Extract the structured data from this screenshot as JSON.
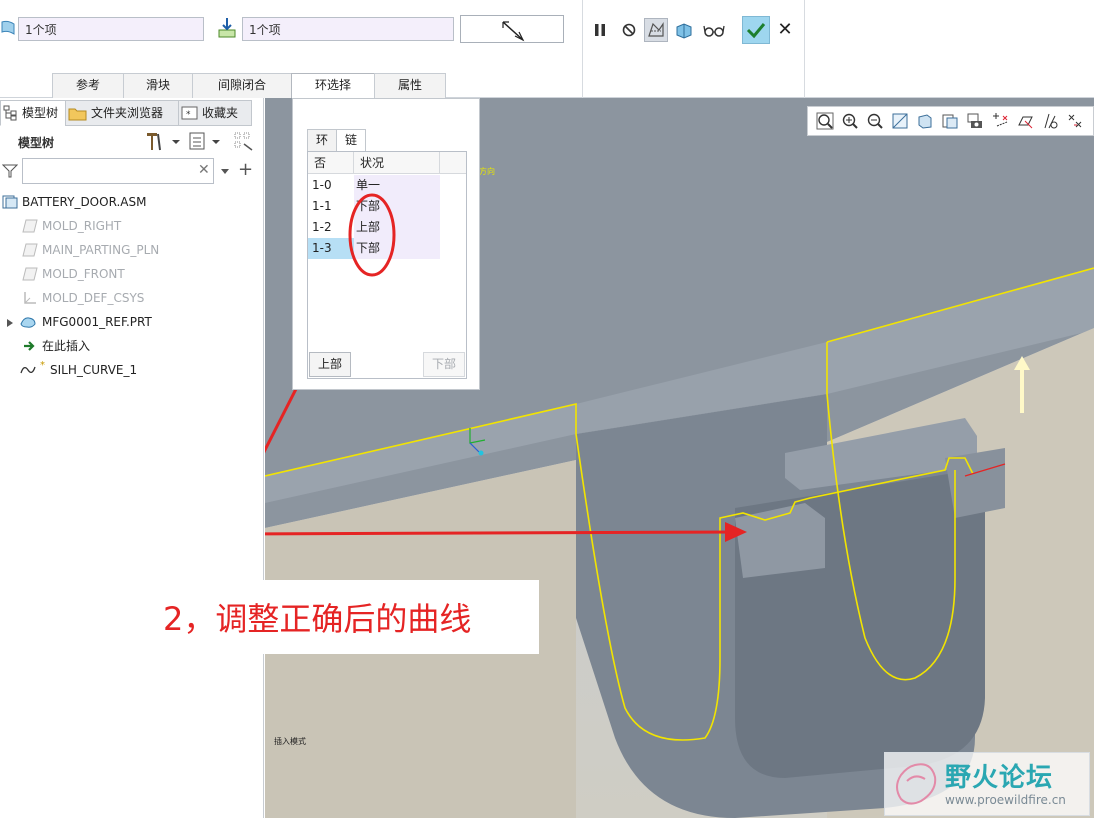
{
  "ribbon": {
    "field_1_value": "1个项",
    "field_2_value": "1个项",
    "tabs": [
      {
        "label": "参考"
      },
      {
        "label": "滑块"
      },
      {
        "label": "间隙闭合"
      },
      {
        "label": "环选择",
        "active": true
      },
      {
        "label": "属性"
      }
    ],
    "accent_ok": "#9ed6ef"
  },
  "left_panel": {
    "tabs": [
      {
        "label": "模型树",
        "active": true
      },
      {
        "label": "文件夹浏览器"
      },
      {
        "label": "收藏夹"
      }
    ],
    "tree_title": "模型树",
    "search_value": "",
    "items": [
      {
        "label": "BATTERY_DOOR.ASM",
        "icon": "assembly-icon"
      },
      {
        "label": "MOLD_RIGHT",
        "icon": "datum-plane-icon",
        "dimmed": true
      },
      {
        "label": "MAIN_PARTING_PLN",
        "icon": "datum-plane-icon",
        "dimmed": true
      },
      {
        "label": "MOLD_FRONT",
        "icon": "datum-plane-icon",
        "dimmed": true
      },
      {
        "label": "MOLD_DEF_CSYS",
        "icon": "coordinate-system-icon",
        "dimmed": true
      },
      {
        "label": "MFG0001_REF.PRT",
        "icon": "part-icon",
        "expandable": true
      },
      {
        "label": "在此插入",
        "icon": "insert-here-arrow-icon"
      },
      {
        "label": "SILH_CURVE_1",
        "icon": "curve-icon"
      }
    ]
  },
  "chain_dialog": {
    "tabs": [
      {
        "label": "环"
      },
      {
        "label": "链",
        "active": true
      }
    ],
    "columns": [
      "否",
      "状况"
    ],
    "rows": [
      {
        "id": "1-0",
        "status": "单一"
      },
      {
        "id": "1-1",
        "status": "下部"
      },
      {
        "id": "1-2",
        "status": "上部"
      },
      {
        "id": "1-3",
        "status": "下部",
        "selected": true
      }
    ],
    "btn_up": "上部",
    "btn_down": "下部"
  },
  "viewport": {
    "direction_label": "方向",
    "insert_mode_label": "插入模式"
  },
  "annotation": {
    "text": "2，调整正确后的曲线",
    "color": "#e52424"
  },
  "watermark": {
    "name": "野火论坛",
    "url": "www.proewildfire.cn"
  }
}
